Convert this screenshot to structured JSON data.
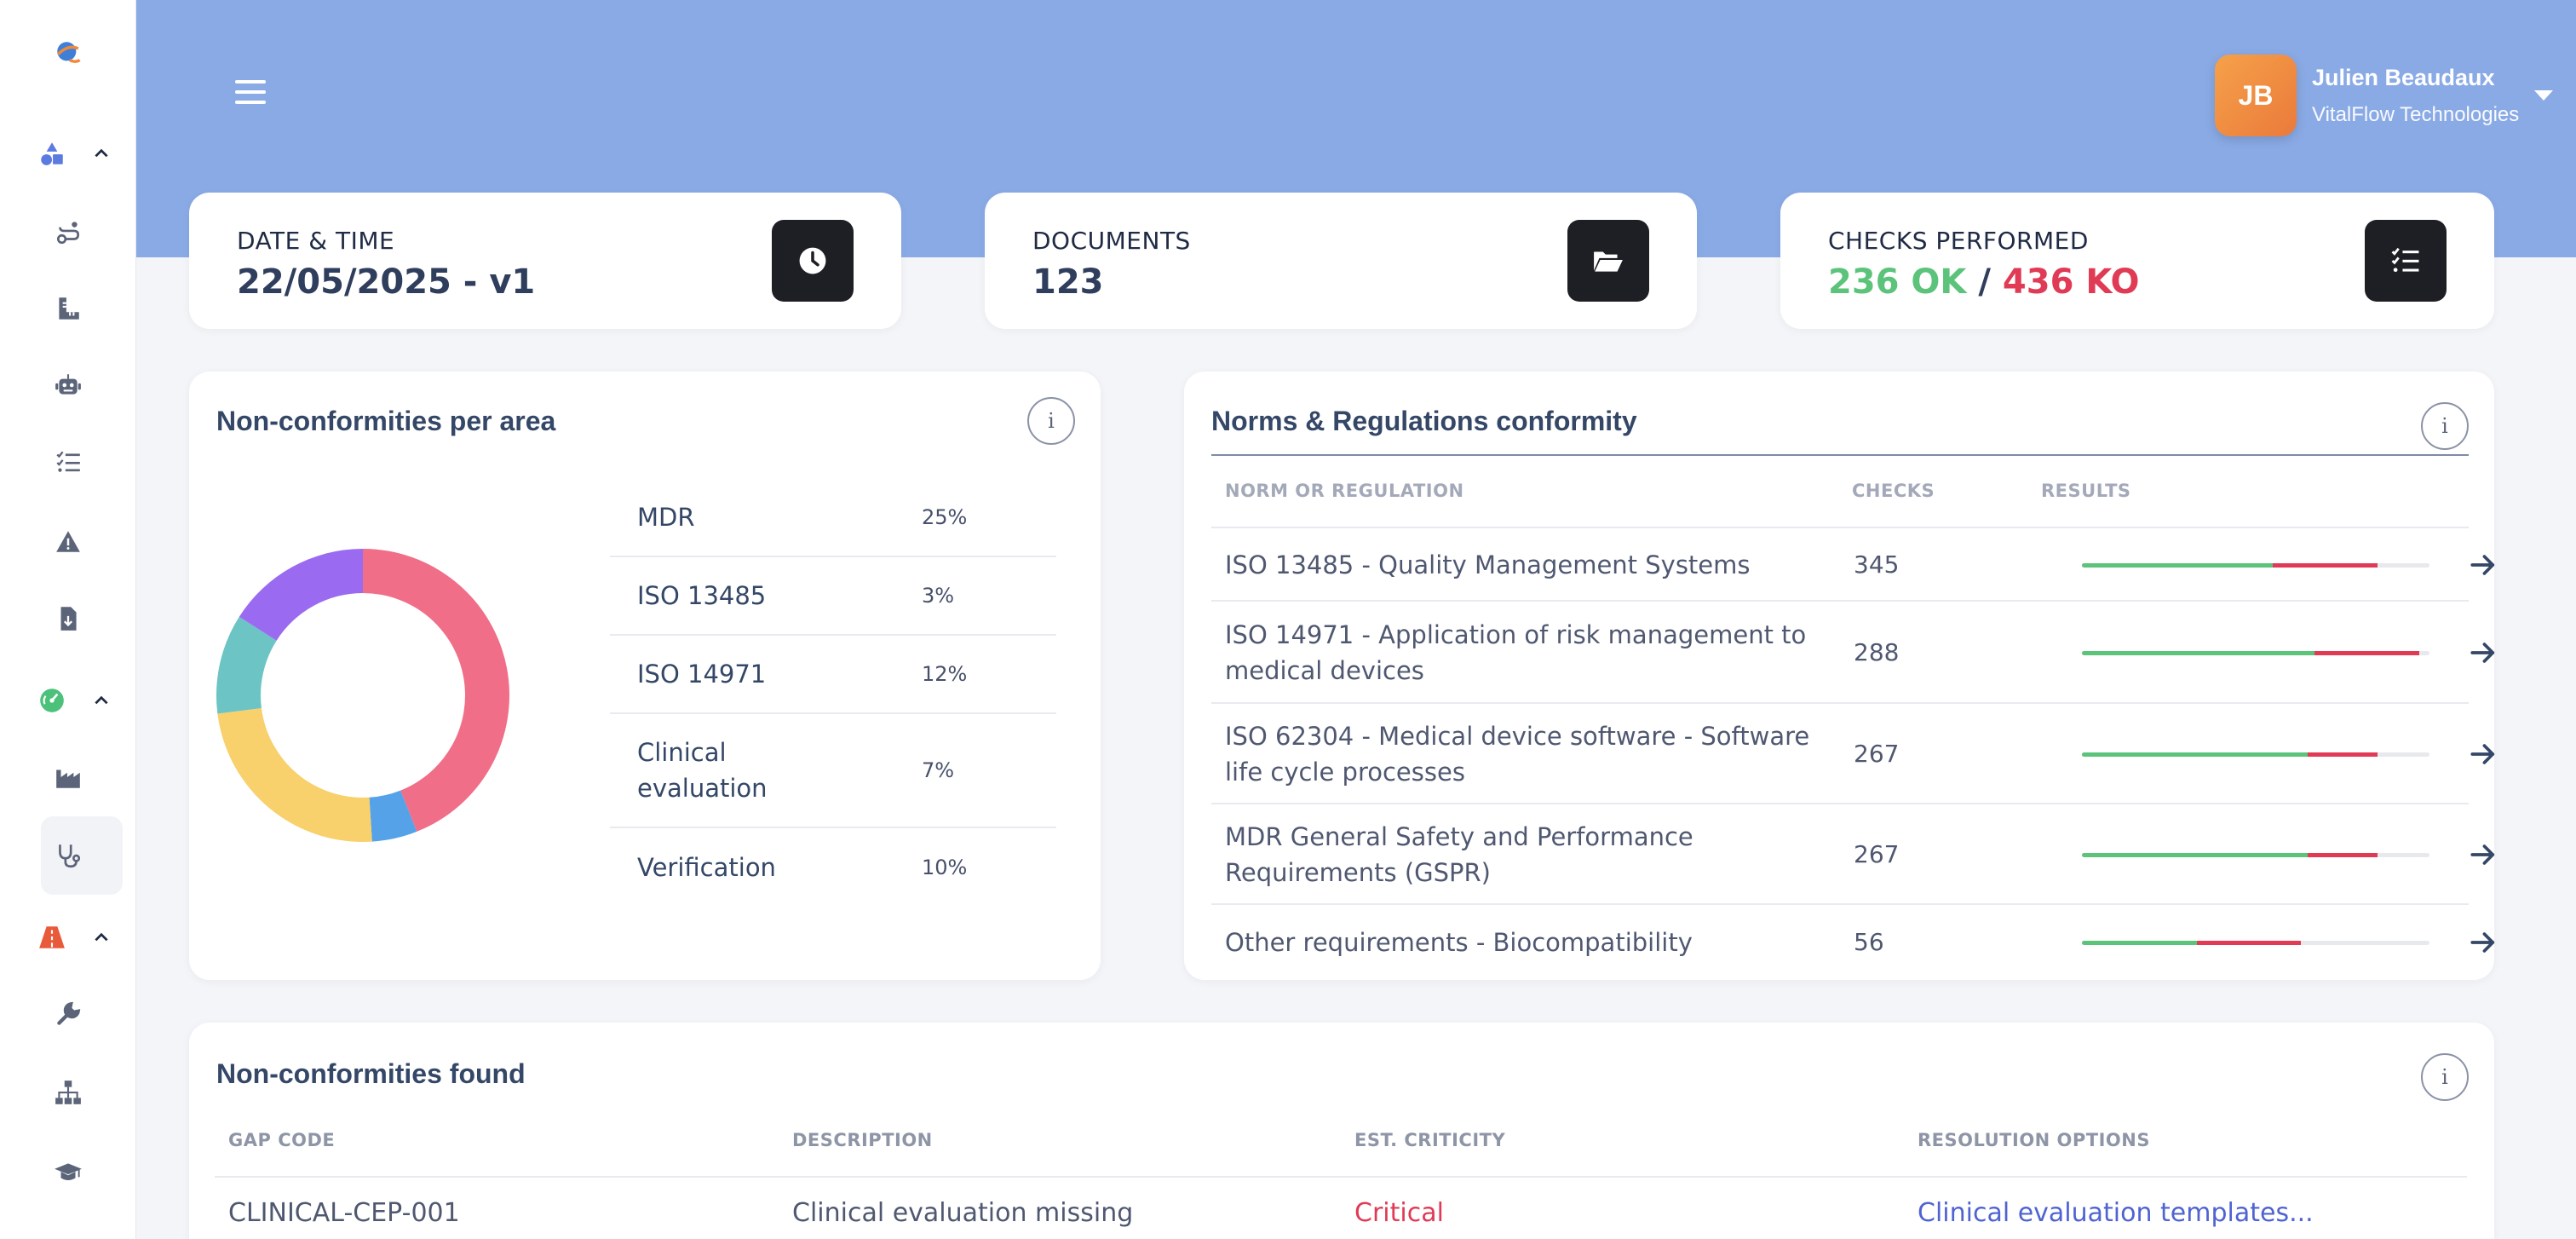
{
  "user": {
    "initials": "JB",
    "name": "Julien Beaudaux",
    "company": "VitalFlow Technologies"
  },
  "stats": {
    "datetime": {
      "label": "DATE & TIME",
      "value": "22/05/2025 - v1",
      "icon": "clock-icon"
    },
    "documents": {
      "label": "DOCUMENTS",
      "value": "123",
      "icon": "folder-open-icon"
    },
    "checks": {
      "label": "CHECKS PERFORMED",
      "ok": "236 OK",
      "separator": "/",
      "ko": "436 KO",
      "icon": "checklist-icon"
    }
  },
  "colors": {
    "accent": "#8aaae6",
    "ok": "#5cc37a",
    "ko": "#e03a55",
    "link": "#4f63d2"
  },
  "area_card": {
    "title": "Non-conformities per area",
    "rows": [
      {
        "name": "MDR",
        "pct": "25%"
      },
      {
        "name": "ISO 13485",
        "pct": "3%"
      },
      {
        "name": "ISO 14971",
        "pct": "12%"
      },
      {
        "name": "Clinical evaluation",
        "pct": "7%"
      },
      {
        "name": "Verification",
        "pct": "10%"
      }
    ]
  },
  "chart_data": {
    "type": "pie",
    "donut": true,
    "values": [
      44,
      5,
      24,
      11,
      16
    ],
    "colors": [
      "#f06e87",
      "#55a2e8",
      "#f8d06c",
      "#6cc4c4",
      "#9a6bf0"
    ]
  },
  "norms_card": {
    "title": "Norms & Regulations conformity",
    "headers": {
      "name": "NORM OR REGULATION",
      "checks": "CHECKS",
      "results": "RESULTS"
    },
    "rows": [
      {
        "name": "ISO 13485 - Quality Management Systems",
        "checks": "345",
        "ok": 0.55,
        "ko": 0.3
      },
      {
        "name": "ISO 14971 - Application of risk management to medical devices",
        "checks": "288",
        "ok": 0.67,
        "ko": 0.3
      },
      {
        "name": "ISO 62304 - Medical device software - Software life cycle processes",
        "checks": "267",
        "ok": 0.65,
        "ko": 0.2
      },
      {
        "name": "MDR General Safety and Performance Requirements (GSPR)",
        "checks": "267",
        "ok": 0.65,
        "ko": 0.2
      },
      {
        "name": "Other requirements - Biocompatibility",
        "checks": "56",
        "ok": 0.33,
        "ko": 0.3
      }
    ]
  },
  "nc_found": {
    "title": "Non-conformities found",
    "headers": {
      "gap": "GAP CODE",
      "desc": "DESCRIPTION",
      "crit": "EST. CRITICITY",
      "res": "RESOLUTION OPTIONS"
    },
    "rows": [
      {
        "gap": "CLINICAL-CEP-001",
        "desc": "Clinical evaluation missing",
        "crit": "Critical",
        "res": "Clinical evaluation templates..."
      }
    ]
  },
  "info_symbol": "i",
  "sidebar_icons": [
    "logo-icon",
    "shapes-icon",
    "route-icon",
    "ruler-icon",
    "robot-icon",
    "list-check-icon",
    "warning-icon",
    "file-import-icon",
    "gauge-icon",
    "industry-icon",
    "stethoscope-icon",
    "road-icon",
    "wrench-icon",
    "sitemap-icon",
    "graduation-cap-icon"
  ]
}
